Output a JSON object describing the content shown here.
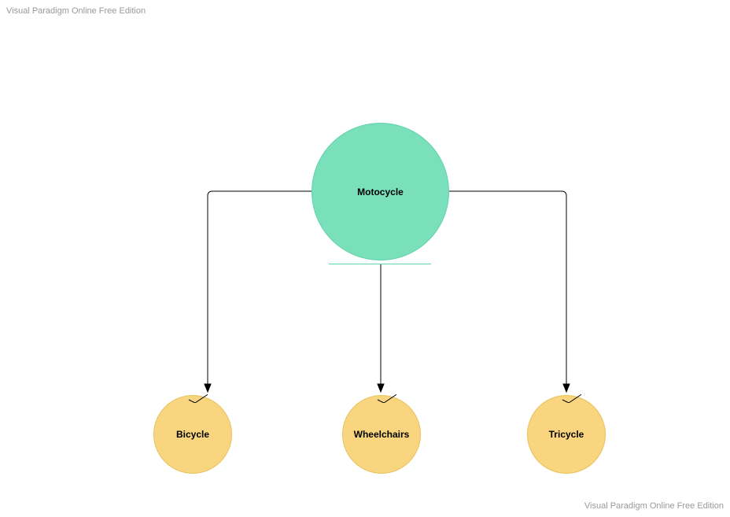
{
  "watermark": {
    "top": "Visual Paradigm Online Free Edition",
    "bottom": "Visual Paradigm Online Free Edition"
  },
  "nodes": {
    "parent": {
      "label": "Motocycle"
    },
    "children": [
      {
        "label": "Bicycle"
      },
      {
        "label": "Wheelchairs"
      },
      {
        "label": "Tricycle"
      }
    ]
  },
  "colors": {
    "parentFill": "#7ae0bb",
    "parentStroke": "#5fd3a8",
    "childFill": "#f8d57e",
    "childStroke": "#e8c260",
    "tickStroke": "#e8b850"
  }
}
